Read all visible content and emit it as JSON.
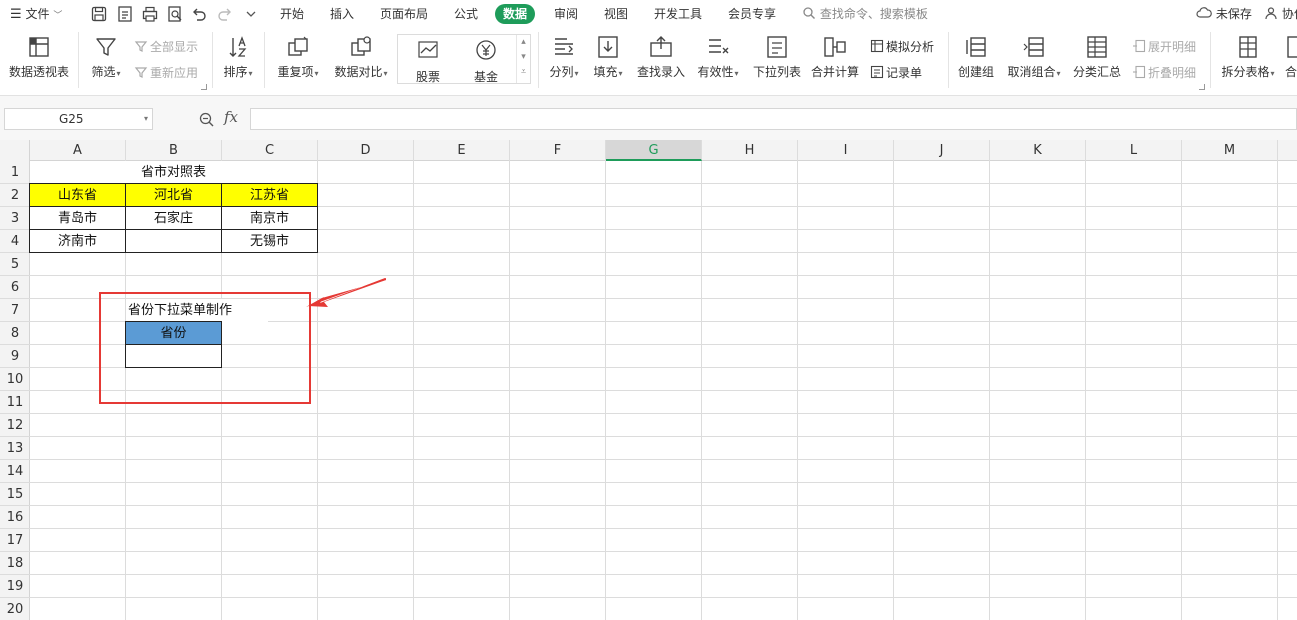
{
  "menubar": {
    "file_label": "文件",
    "tabs": [
      "开始",
      "插入",
      "页面布局",
      "公式",
      "数据",
      "审阅",
      "视图",
      "开发工具",
      "会员专享"
    ],
    "active_tab": "数据",
    "search_placeholder": "查找命令、搜索模板",
    "unsaved_label": "未保存",
    "collab_label": "协作"
  },
  "ribbon": {
    "pivot_label": "数据透视表",
    "filter_label": "筛选",
    "show_all_label": "全部显示",
    "reapply_label": "重新应用",
    "sort_label": "排序",
    "duplicates_label": "重复项",
    "compare_label": "数据对比",
    "stock_label": "股票",
    "fund_label": "基金",
    "split_label": "分列",
    "fill_label": "填充",
    "lookup_label": "查找录入",
    "validity_label": "有效性",
    "dropdown_label": "下拉列表",
    "consolidate_label": "合并计算",
    "simulate_label": "模拟分析",
    "record_label": "记录单",
    "group_label": "创建组",
    "ungroup_label": "取消组合",
    "subtotal_label": "分类汇总",
    "expand_label": "展开明细",
    "collapse_label": "折叠明细",
    "split_table_label": "拆分表格",
    "merge_table_label": "合"
  },
  "formula_bar": {
    "name_box": "G25",
    "fx_label": "fx",
    "formula": ""
  },
  "columns": [
    "A",
    "B",
    "C",
    "D",
    "E",
    "F",
    "G",
    "H",
    "I",
    "J",
    "K",
    "L",
    "M"
  ],
  "selected_column": "G",
  "rows": [
    "1",
    "2",
    "3",
    "4",
    "5",
    "6",
    "7",
    "8",
    "9",
    "10",
    "11",
    "12",
    "13",
    "14",
    "15",
    "16",
    "17",
    "18",
    "19",
    "20"
  ],
  "sheet": {
    "title": "省市对照表",
    "header_row": [
      "山东省",
      "河北省",
      "江苏省"
    ],
    "row3": [
      "青岛市",
      "石家庄",
      "南京市"
    ],
    "row4": [
      "济南市",
      "",
      "无锡市"
    ],
    "dropdown_caption": "省份下拉菜单制作",
    "dropdown_header": "省份",
    "dropdown_value": ""
  },
  "colors": {
    "accent_green": "#1e9c5a",
    "header_yellow": "#ffff00",
    "header_blue": "#5b9bd5",
    "annotation_red": "#e53935"
  }
}
